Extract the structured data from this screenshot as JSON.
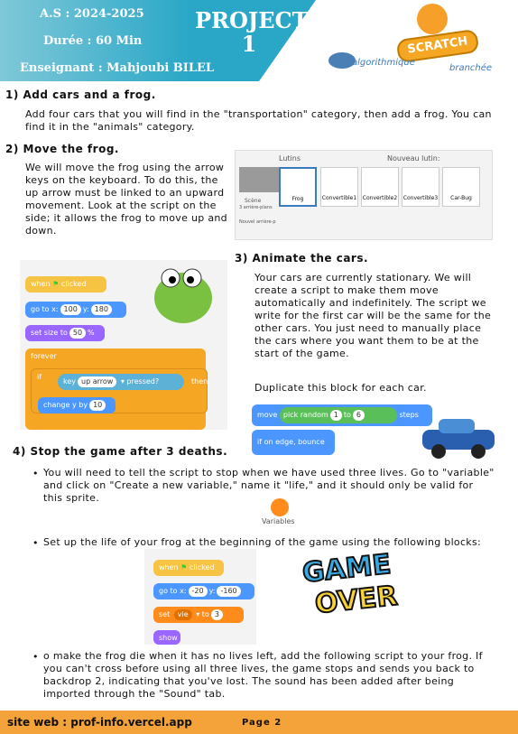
{
  "header": {
    "year": "A.S : 2024-2025",
    "duration": "Durée : 60 Min",
    "teacher": "Enseignant : Mahjoubi BILEL",
    "project": "PROJECT",
    "project_num": "1",
    "logo": "SCRATCH",
    "algo": "algorithmique",
    "branch": "branchée"
  },
  "s1": {
    "title": "1) Add cars and a frog.",
    "text": "Add four cars that you will find in the \"transportation\" category, then add a frog. You can find it in the \"animals\" category."
  },
  "s2": {
    "title": "2) Move the frog.",
    "text": "We will move the frog using the arrow keys on the keyboard. To do this, the up arrow must be linked to an upward movement. Look at the script on the side; it allows the frog to move up and down."
  },
  "sprites_panel": {
    "label": "Lutins",
    "new": "Nouveau lutin:",
    "scene": "Scène",
    "backdrops": "3 arrière-plans",
    "new_backdrop": "Nouvel arrière-p",
    "sprites": [
      "Frog",
      "Convertible1",
      "Convertible2",
      "Convertible3",
      "Car-Bug"
    ]
  },
  "script1": {
    "when": "when",
    "clicked": "clicked",
    "goto": "go to x:",
    "x": "100",
    "y_label": "y:",
    "y": "180",
    "size": "set size to",
    "size_val": "50",
    "pct": "%",
    "forever": "forever",
    "if": "if",
    "key": "key",
    "arrow": "up arrow",
    "pressed": "pressed?",
    "then": "then",
    "change": "change y by",
    "change_val": "10"
  },
  "s3": {
    "title": "3) Animate the cars.",
    "text": "Your cars are currently stationary. We will create a script to make them move automatically and indefinitely. The script we write for the first car will be the same for the other cars. You just need to manually place the cars where you want them to be at the start of the game.",
    "text2": "Duplicate this block for each car."
  },
  "script2": {
    "move": "move",
    "pick": "pick random",
    "a": "1",
    "to": "to",
    "b": "6",
    "steps": "steps",
    "edge": "if on edge, bounce"
  },
  "s4": {
    "title": "4) Stop the game after 3 deaths.",
    "b1": "You will need to tell the script to stop when we have used three lives. Go to \"variable\" and click on \"Create a new variable,\" name it \"life,\" and it should only be valid for this sprite.",
    "variables": "Variables",
    "b2": "Set up the life of your frog at the beginning of the game using the following blocks:",
    "b3": "o make the frog die when it has no lives left, add the following script to your frog. If you can't cross before using all three lives, the game stops and sends you back to backdrop 2, indicating that you've lost. The sound has been added after being imported through the \"Sound\" tab."
  },
  "script3": {
    "when": "when",
    "clicked": "clicked",
    "goto": "go to x:",
    "x": "-20",
    "y_label": "y:",
    "y": "-160",
    "set": "set",
    "var": "vie",
    "to": "to",
    "val": "3",
    "show": "show"
  },
  "gameover": {
    "l1": "GAME",
    "l2": "OVER"
  },
  "footer": {
    "site": "site web : prof-info.vercel.app",
    "page": "Page 2"
  }
}
